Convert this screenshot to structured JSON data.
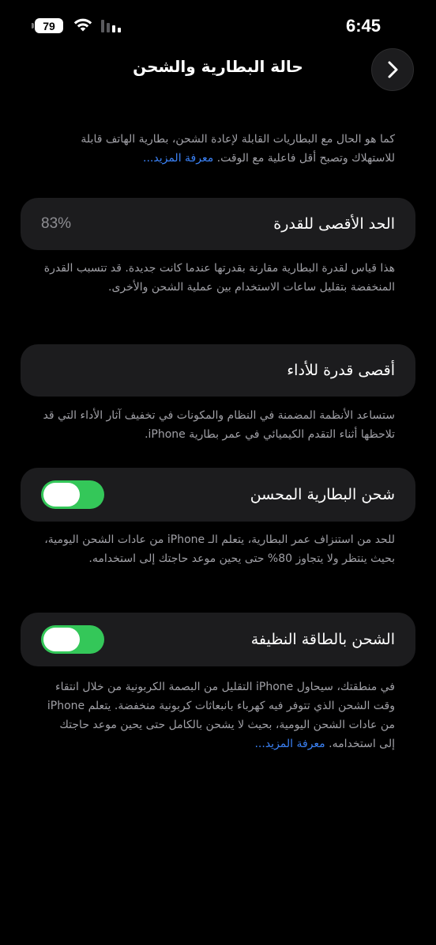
{
  "status_bar": {
    "time": "6:45",
    "battery_level": "79",
    "wifi_icon": "wifi-icon",
    "signal_icon": "cellular-signal-icon"
  },
  "nav": {
    "title": "حالة البطارية والشحن",
    "back_icon": "chevron-right-icon"
  },
  "intro": {
    "text": "كما هو الحال مع البطاريات القابلة لإعادة الشحن، بطارية الهاتف قابلة للاستهلاك وتصبح أقل فاعلية مع الوقت.",
    "link": "معرفة المزيد..."
  },
  "max_capacity": {
    "label": "الحد الأقصى للقدرة",
    "value": "83%",
    "description": "هذا قياس لقدرة البطارية مقارنة بقدرتها عندما كانت جديدة. قد تتسبب القدرة المنخفضة بتقليل ساعات الاستخدام بين عملية الشحن والأخرى."
  },
  "peak_performance": {
    "label": "أقصى قدرة للأداء",
    "description": "ستساعد الأنظمة المضمنة في النظام والمكونات في تخفيف آثار الأداء التي قد تلاحظها أثناء التقدم الكيميائي في عمر بطارية iPhone."
  },
  "optimized_charging": {
    "label": "شحن البطارية المحسن",
    "enabled": true,
    "description": "للحد من استنزاف عمر البطارية، يتعلم الـ iPhone من عادات الشحن اليومية، بحيث ينتظر ولا يتجاوز 80% حتى يحين موعد حاجتك إلى استخدامه."
  },
  "clean_energy": {
    "label": "الشحن بالطاقة النظيفة",
    "enabled": true,
    "description": "في منطقتك، سيحاول iPhone التقليل من البصمة الكربونية من خلال انتقاء وقت الشحن الذي تتوفر فيه كهرباء بانبعاثات كربونية منخفضة. يتعلم iPhone من عادات الشحن اليومية، بحيث لا يشحن بالكامل حتى يحين موعد حاجتك إلى استخدامه.",
    "link": "معرفة المزيد..."
  },
  "colors": {
    "background": "#000000",
    "cell": "#1c1c1e",
    "secondary_text": "#a0a0a6",
    "link": "#3b82f6",
    "toggle_on": "#34c759"
  }
}
